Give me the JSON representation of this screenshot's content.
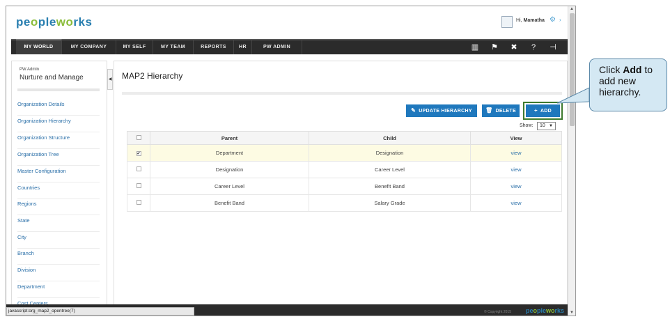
{
  "header": {
    "logo": {
      "a": "pe",
      "b": "o",
      "c": "ple",
      "d": "w",
      "e": "o",
      "f": "rks"
    },
    "greeting_prefix": "Hi,",
    "user_name": "Mamatha"
  },
  "nav": {
    "items": [
      "MY WORLD",
      "MY COMPANY",
      "MY SELF",
      "MY TEAM",
      "REPORTS",
      "HR",
      "PW ADMIN"
    ]
  },
  "left_panel": {
    "small_title": "PW Admin",
    "title": "Nurture and Manage",
    "items": [
      "Organization Details",
      "Organization Hierarchy",
      "Organization Structure",
      "Organization Tree",
      "Master Configuration",
      "Countries",
      "Regions",
      "State",
      "City",
      "Branch",
      "Division",
      "Department",
      "Cost Centers"
    ]
  },
  "main": {
    "title": "MAP2 Hierarchy",
    "buttons": {
      "update": "UPDATE HIERARCHY",
      "delete": "DELETE",
      "add": "ADD"
    },
    "show_label": "Show:",
    "show_value": "10",
    "table": {
      "headers": [
        "Parent",
        "Child",
        "View"
      ],
      "rows": [
        {
          "checked": true,
          "parent": "Department",
          "child": "Designation",
          "view": "view"
        },
        {
          "checked": false,
          "parent": "Designation",
          "child": "Career Level",
          "view": "view"
        },
        {
          "checked": false,
          "parent": "Career Level",
          "child": "Benefit Band",
          "view": "view"
        },
        {
          "checked": false,
          "parent": "Benefit Band",
          "child": "Salary Grade",
          "view": "view"
        }
      ]
    }
  },
  "footer": {
    "status_url": "javascript:org_map2_opentree(7)",
    "copyright": "© Copyright 2015"
  },
  "callout": {
    "pre": "Click ",
    "bold": "Add",
    "post": " to add new hierarchy."
  },
  "colors": {
    "accent_blue": "#1f78bd",
    "highlight_green": "#3e7a2e",
    "callout_bg": "#d4e8f3"
  }
}
